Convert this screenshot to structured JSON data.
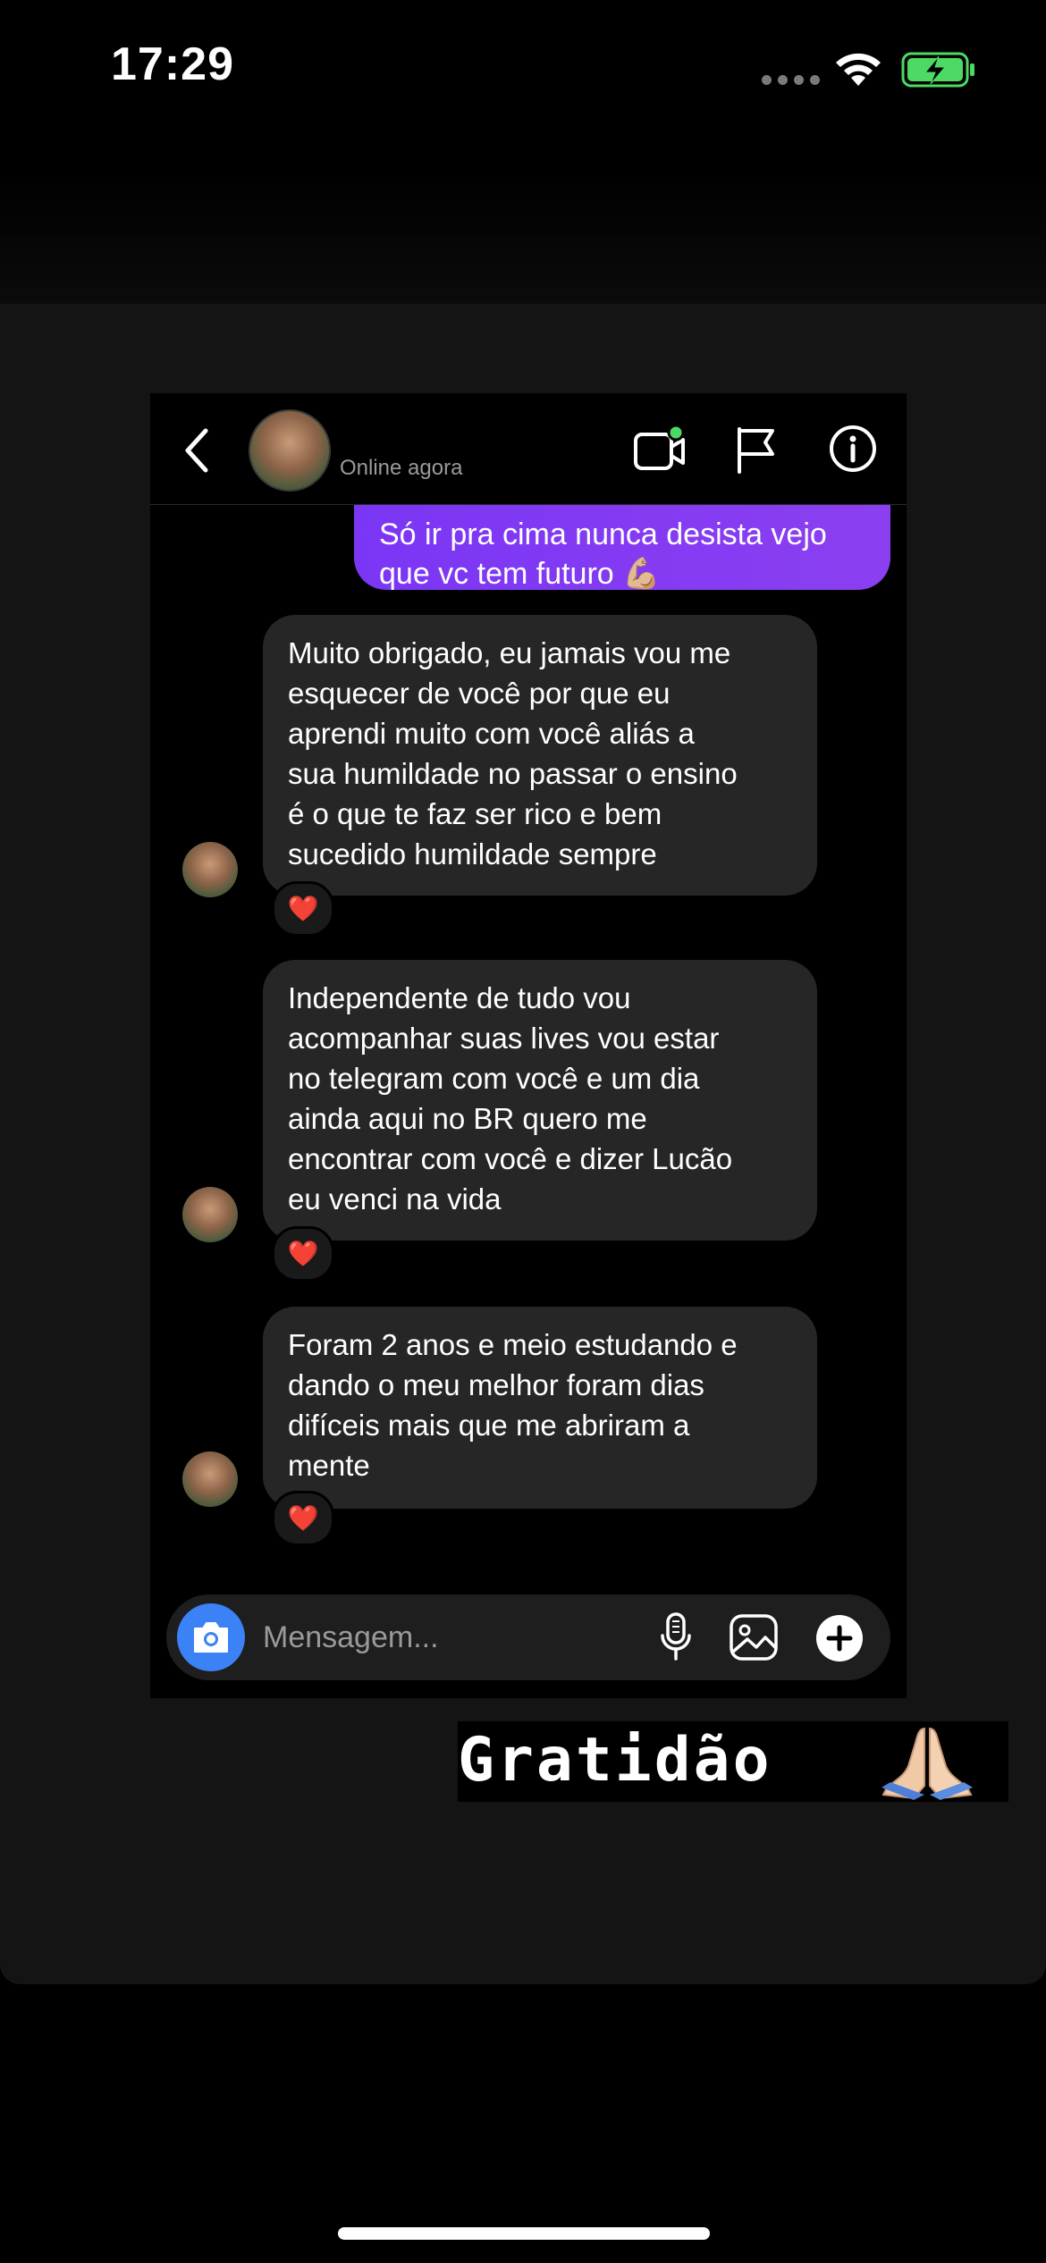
{
  "status_bar": {
    "time": "17:29",
    "icons": [
      "signal-dots-icon",
      "wifi-icon",
      "battery-charging-icon"
    ],
    "battery_color": "#4cd964"
  },
  "chat": {
    "header": {
      "online_status": "Online agora",
      "icons": [
        "back-icon",
        "video-call-icon",
        "flag-icon",
        "info-icon"
      ],
      "video_call_status_dot_color": "#4cd964"
    },
    "sent_message": {
      "text": "Só ir pra cima nunca desista vejo que vc tem futuro 💪🏼",
      "color": "#7b36f5"
    },
    "received_messages": [
      {
        "text": "Muito obrigado, eu jamais vou me\nesquecer de você por que eu\naprendi muito com você aliás a\nsua humildade no passar o ensino\né o que te faz ser rico e bem\nsucedido humildade sempre",
        "reaction": "❤️"
      },
      {
        "text": "Independente de tudo vou\nacompanhar suas lives vou estar\nno telegram com você e um dia\nainda aqui no BR quero me\nencontrar com você e dizer Lucão\neu venci na vida",
        "reaction": "❤️"
      },
      {
        "text": "Foram 2 anos e meio estudando e\ndando o meu melhor foram dias\ndifíceis mais que me abriram a\nmente",
        "reaction": "❤️"
      }
    ],
    "composer": {
      "placeholder": "Mensagem...",
      "icons": [
        "camera-icon",
        "microphone-icon",
        "gallery-icon",
        "plus-icon"
      ],
      "camera_color": "#3b82f6"
    }
  },
  "story": {
    "sticker_text": "Gratidão",
    "sticker_icon": "folded-hands-icon"
  }
}
